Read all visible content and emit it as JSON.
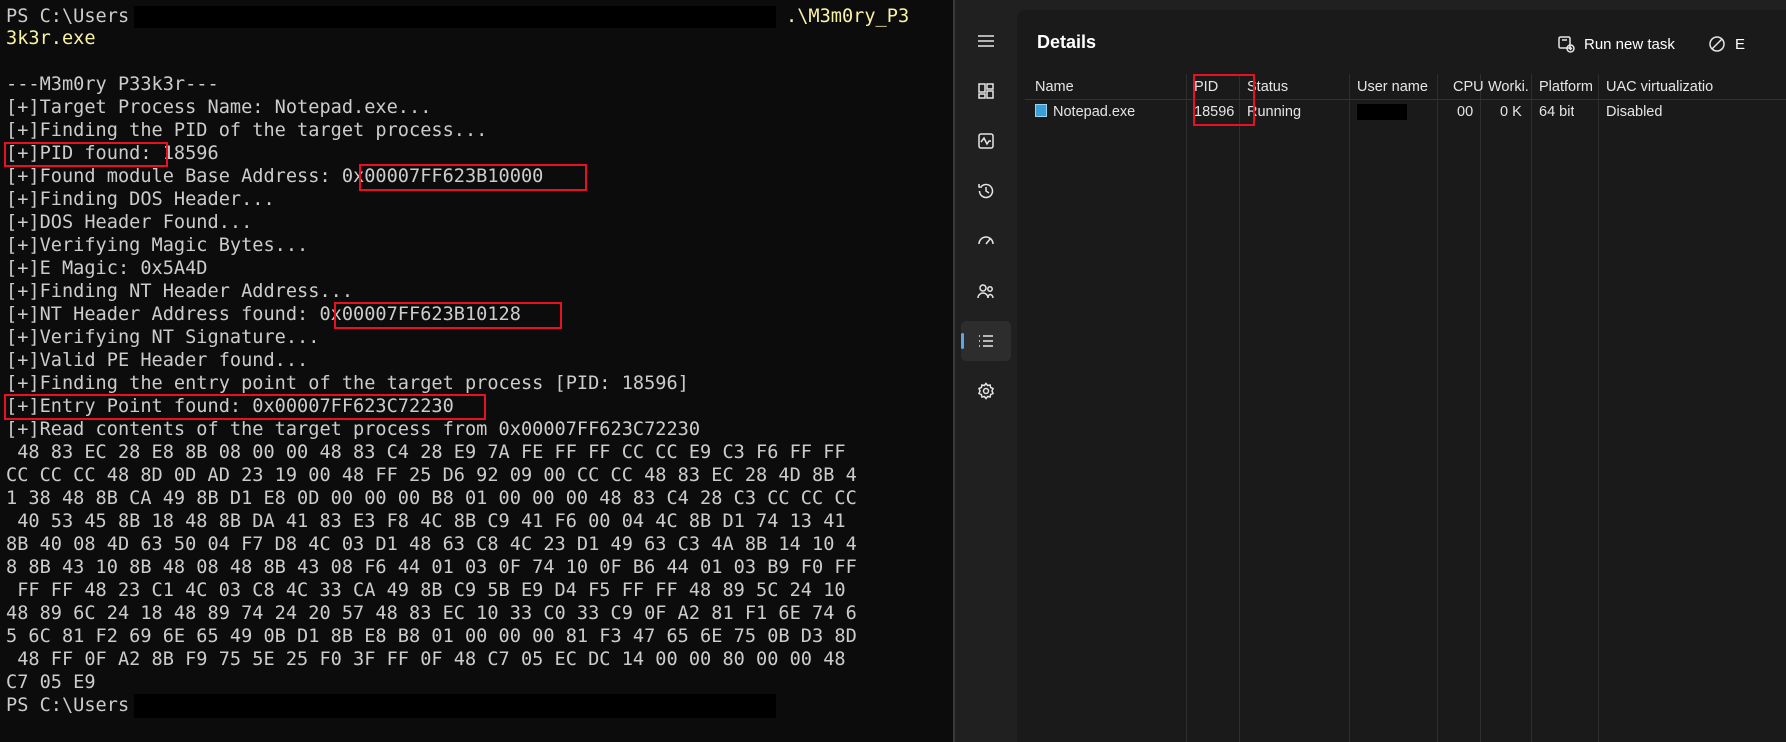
{
  "terminal": {
    "prompt_prefix": "PS C:\\Users",
    "command_tail": ".\\M3m0ry_P3",
    "command_wrap": "3k3r.exe",
    "lines": [
      "---M3m0ry P33k3r---",
      "[+]Target Process Name: Notepad.exe...",
      "[+]Finding the PID of the target process...",
      "[+]PID found: 18596",
      "[+]Found module Base Address: 0x00007FF623B10000",
      "[+]Finding DOS Header...",
      "[+]DOS Header Found...",
      "[+]Verifying Magic Bytes...",
      "[+]E Magic: 0x5A4D",
      "[+]Finding NT Header Address...",
      "[+]NT Header Address found: 0x00007FF623B10128",
      "[+]Verifying NT Signature...",
      "[+]Valid PE Header found...",
      "[+]Finding the entry point of the target process [PID: 18596]",
      "[+]Entry Point found: 0x00007FF623C72230",
      "[+]Read contents of the target process from 0x00007FF623C72230",
      " 48 83 EC 28 E8 8B 08 00 00 48 83 C4 28 E9 7A FE FF FF CC CC E9 C3 F6 FF FF",
      "CC CC CC 48 8D 0D AD 23 19 00 48 FF 25 D6 92 09 00 CC CC 48 83 EC 28 4D 8B 4",
      "1 38 48 8B CA 49 8B D1 E8 0D 00 00 00 B8 01 00 00 00 48 83 C4 28 C3 CC CC CC",
      " 40 53 45 8B 18 48 8B DA 41 83 E3 F8 4C 8B C9 41 F6 00 04 4C 8B D1 74 13 41",
      "8B 40 08 4D 63 50 04 F7 D8 4C 03 D1 48 63 C8 4C 23 D1 49 63 C3 4A 8B 14 10 4",
      "8 8B 43 10 8B 48 08 48 8B 43 08 F6 44 01 03 0F 74 10 0F B6 44 01 03 B9 F0 FF",
      " FF FF 48 23 C1 4C 03 C8 4C 33 CA 49 8B C9 5B E9 D4 F5 FF FF 48 89 5C 24 10",
      "48 89 6C 24 18 48 89 74 24 20 57 48 83 EC 10 33 C0 33 C9 0F A2 81 F1 6E 74 6",
      "5 6C 81 F2 69 6E 65 49 0B D1 8B E8 B8 01 00 00 00 81 F3 47 65 6E 75 0B D3 8D",
      " 48 FF 0F A2 8B F9 75 5E 25 F0 3F FF 0F 48 C7 05 EC DC 14 00 00 80 00 00 48",
      "C7 05 E9"
    ],
    "final_prompt": "PS C:\\Users"
  },
  "taskmgr": {
    "page_title": "Details",
    "run_new_task": "Run new task",
    "end_task_partial": "E",
    "nav": [
      "menu-icon",
      "processes-icon",
      "performance-icon",
      "app-history-icon",
      "startup-apps-icon",
      "users-icon",
      "details-icon",
      "services-icon"
    ],
    "columns": [
      "Name",
      "PID",
      "Status",
      "User name",
      "CPU",
      "Worki...",
      "Platform",
      "UAC virtualizatio"
    ],
    "rows": [
      {
        "name": "Notepad.exe",
        "pid": "18596",
        "status": "Running",
        "user": "",
        "cpu": "00",
        "working_set": "0 K",
        "platform": "64 bit",
        "uac": "Disabled"
      }
    ]
  },
  "colors": {
    "highlight": "#e81123",
    "terminal_bg": "#0c0c0c",
    "taskmgr_bg": "#202020",
    "accent": "#5ea5e6"
  }
}
